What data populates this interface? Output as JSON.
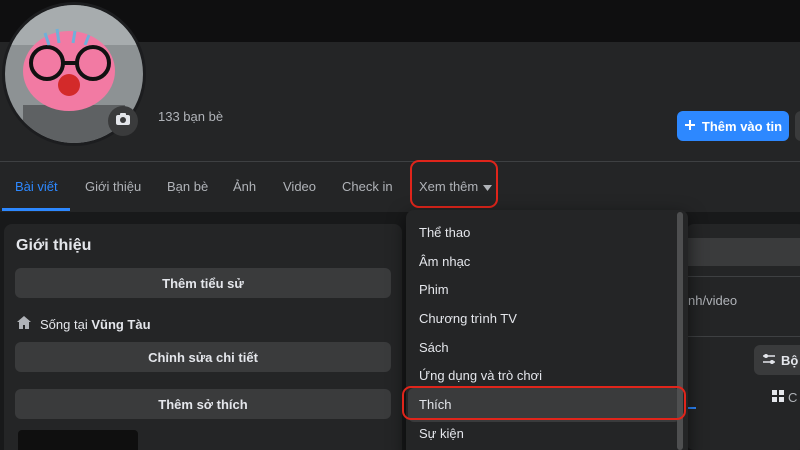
{
  "profile": {
    "friends_count": "133 bạn bè",
    "add_story_label": "Thêm vào tin"
  },
  "tabs": [
    {
      "label": "Bài viết",
      "active": true
    },
    {
      "label": "Giới thiệu",
      "active": false
    },
    {
      "label": "Bạn bè",
      "active": false
    },
    {
      "label": "Ảnh",
      "active": false
    },
    {
      "label": "Video",
      "active": false
    },
    {
      "label": "Check in",
      "active": false
    },
    {
      "label": "Xem thêm",
      "active": false
    }
  ],
  "intro": {
    "title": "Giới thiệu",
    "add_bio": "Thêm tiểu sử",
    "lives_in_prefix": "Sống tại",
    "lives_in_city": "Vũng Tàu",
    "edit_details": "Chỉnh sửa chi tiết",
    "add_hobbies": "Thêm sở thích"
  },
  "dropdown": {
    "items": [
      "Thể thao",
      "Âm nhạc",
      "Phim",
      "Chương trình TV",
      "Sách",
      "Ứng dụng và trò chơi",
      "Thích",
      "Sự kiện"
    ],
    "selected": "Thích"
  },
  "right_panel": {
    "media_text": "nh/video",
    "filter_label": "Bộ",
    "grid_label": "C"
  },
  "colors": {
    "accent": "#2d88ff",
    "highlight": "#e0251b",
    "background": "#18191a",
    "card": "#242526"
  }
}
